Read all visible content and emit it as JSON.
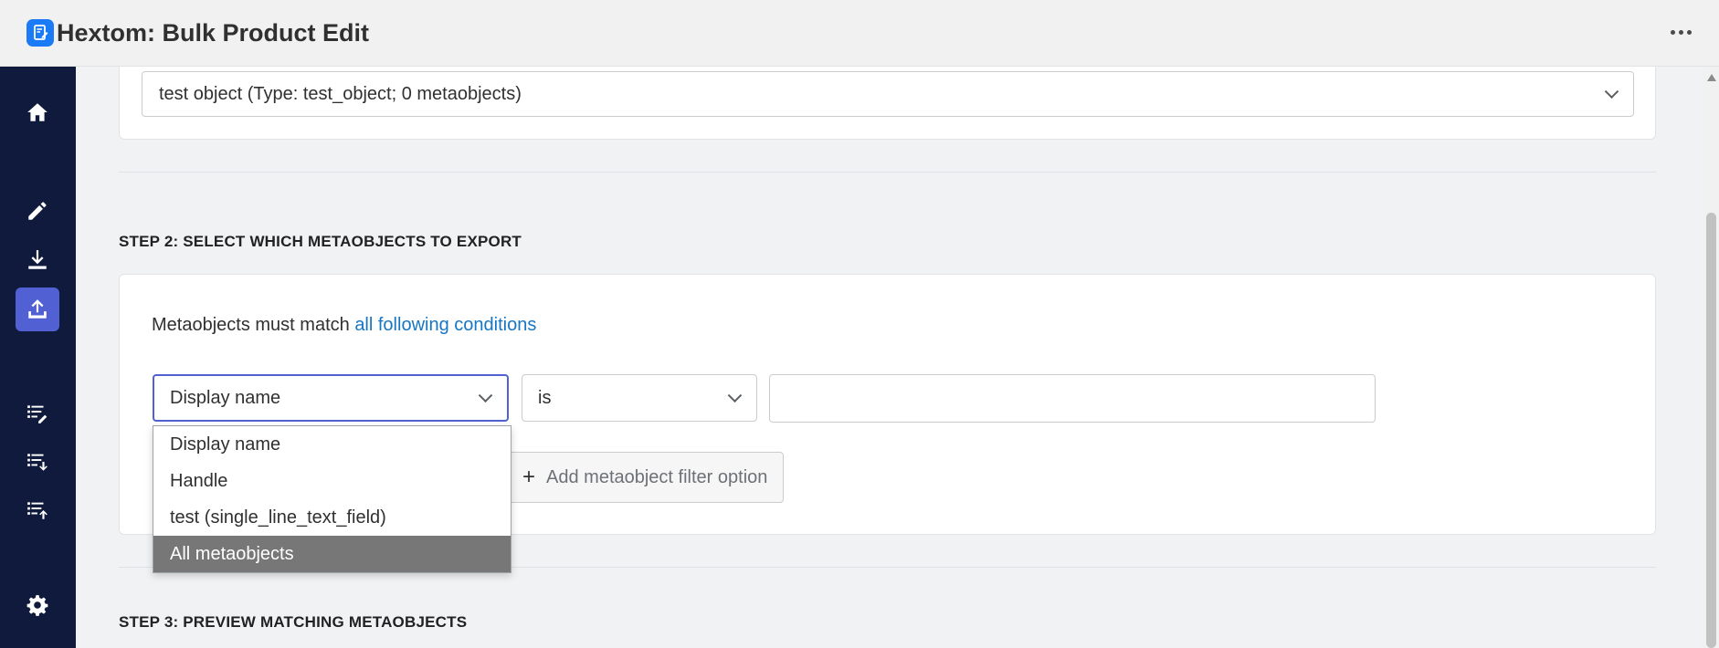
{
  "app": {
    "title": "Hextom: Bulk Product Edit",
    "accent_color": "#5160d2",
    "sidebar_color": "#0f1a3c"
  },
  "sidebar": {
    "items": [
      {
        "icon": "home-icon",
        "label": "Home"
      },
      {
        "icon": "pencil-icon",
        "label": "Edit"
      },
      {
        "icon": "download-icon",
        "label": "Import"
      },
      {
        "icon": "upload-icon",
        "label": "Export",
        "active": true
      },
      {
        "icon": "list-edit-icon",
        "label": "List edit"
      },
      {
        "icon": "list-download-icon",
        "label": "List import"
      },
      {
        "icon": "list-upload-icon",
        "label": "List export"
      },
      {
        "icon": "gear-icon",
        "label": "Settings"
      }
    ]
  },
  "step1": {
    "selected_definition": "test object (Type: test_object; 0 metaobjects)"
  },
  "step2": {
    "title": "STEP 2: SELECT WHICH METAOBJECTS TO EXPORT",
    "condition_prefix": "Metaobjects must match ",
    "condition_link": "all following conditions",
    "field_select": "Display name",
    "operator_select": "is",
    "value_input": "",
    "add_button": "Add metaobject filter option",
    "dropdown_options": [
      {
        "label": "Display name",
        "selected": false
      },
      {
        "label": "Handle",
        "selected": false
      },
      {
        "label": "test (single_line_text_field)",
        "selected": false
      },
      {
        "label": "All metaobjects",
        "selected": true
      }
    ]
  },
  "step3": {
    "title": "STEP 3: PREVIEW MATCHING METAOBJECTS"
  }
}
